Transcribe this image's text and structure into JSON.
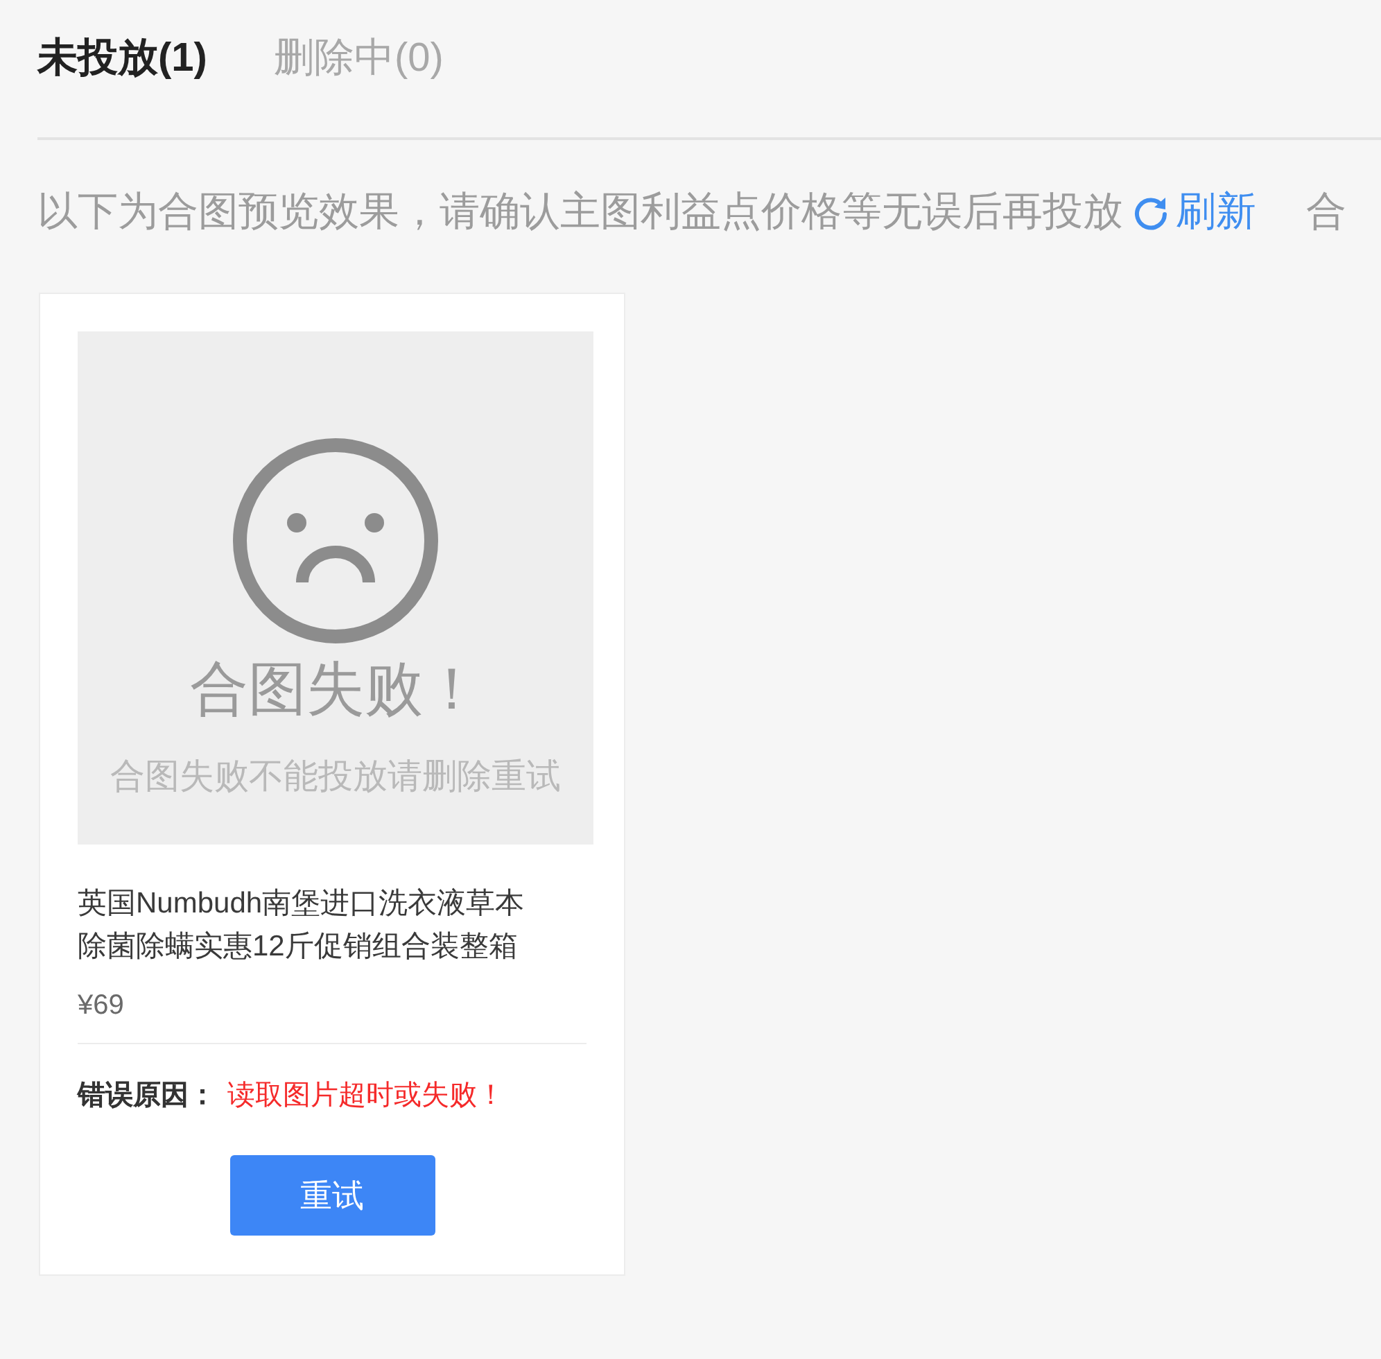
{
  "tabs": [
    {
      "label": "未投放(1)",
      "selected": true
    },
    {
      "label": "删除中(0)",
      "selected": false
    }
  ],
  "notice": {
    "text": "以下为合图预览效果，请确认主图利益点价格等无误后再投放",
    "refresh_link": "刷新",
    "next_text": "合"
  },
  "cards": [
    {
      "preview": {
        "kind": "failed",
        "headline": "合图失败！",
        "hint": "合图失败不能投放请删除重试"
      },
      "title": "英国Numbudh南堡进口洗衣液草本除菌除螨实惠12斤促销组合装整箱",
      "price": "¥69",
      "error": {
        "label": "错误原因：",
        "message": "读取图片超时或失败！"
      },
      "button": "重试"
    }
  ]
}
